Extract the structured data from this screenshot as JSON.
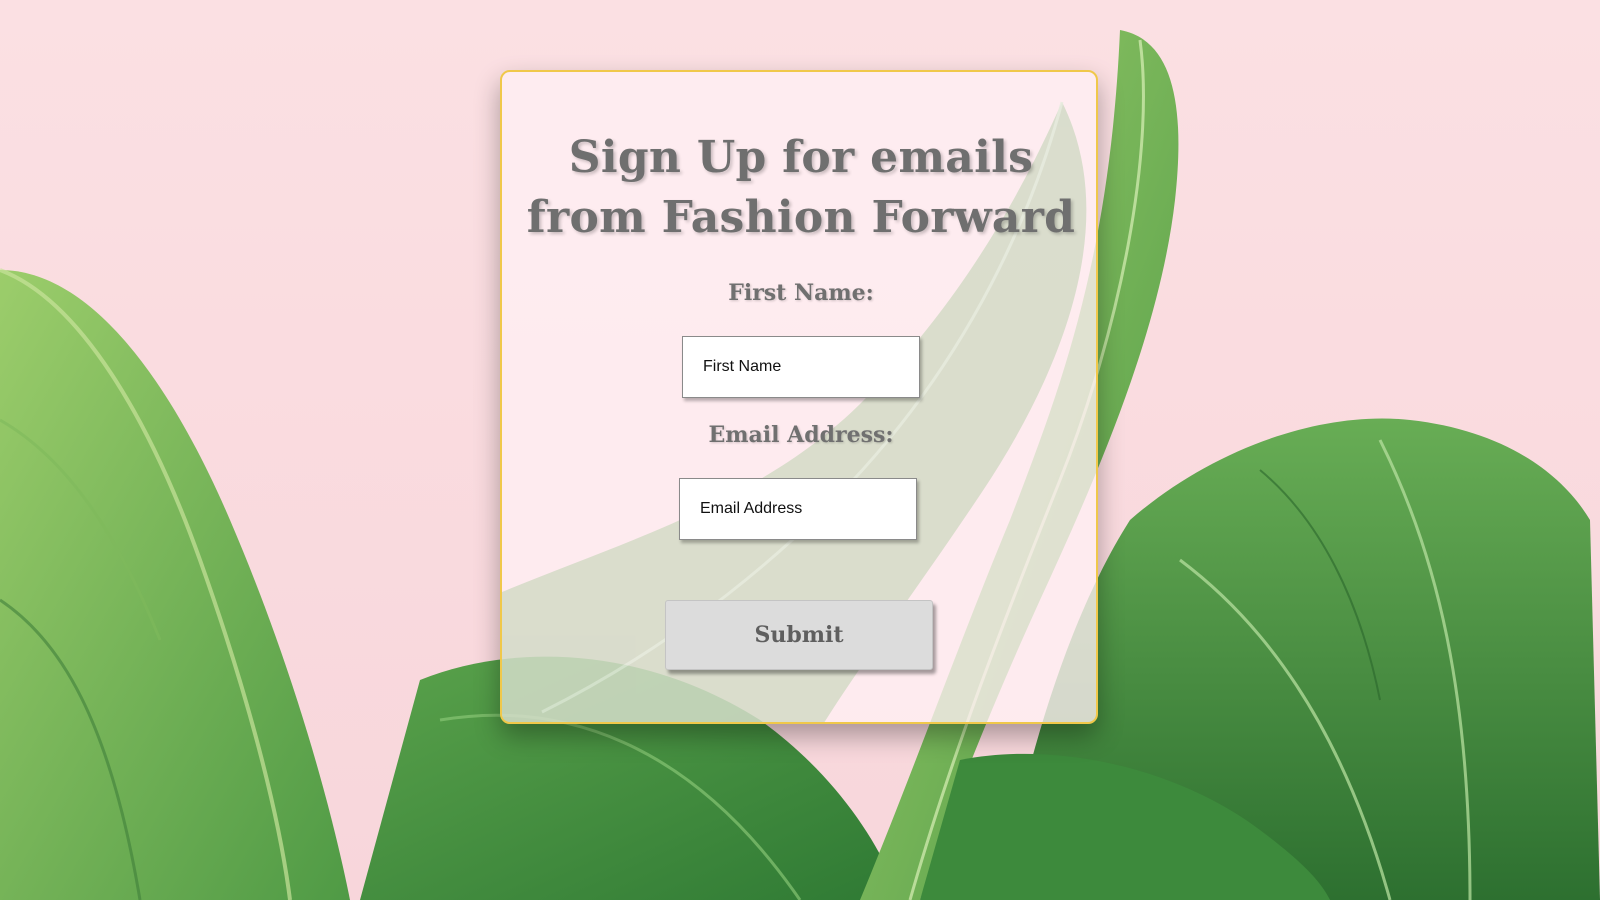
{
  "form": {
    "title": "Sign Up for emails from Fashion Forward",
    "first_name_label": "First Name:",
    "first_name_placeholder": "First Name",
    "email_label": "Email Address:",
    "email_placeholder": "Email Address",
    "submit_label": "Submit"
  },
  "colors": {
    "background_pink": "#f9d8dd",
    "card_border": "#f0c84a",
    "text_gray": "#6f6f6f",
    "button_gray": "#dcdcdc",
    "leaf_green": "#4f9a45"
  }
}
